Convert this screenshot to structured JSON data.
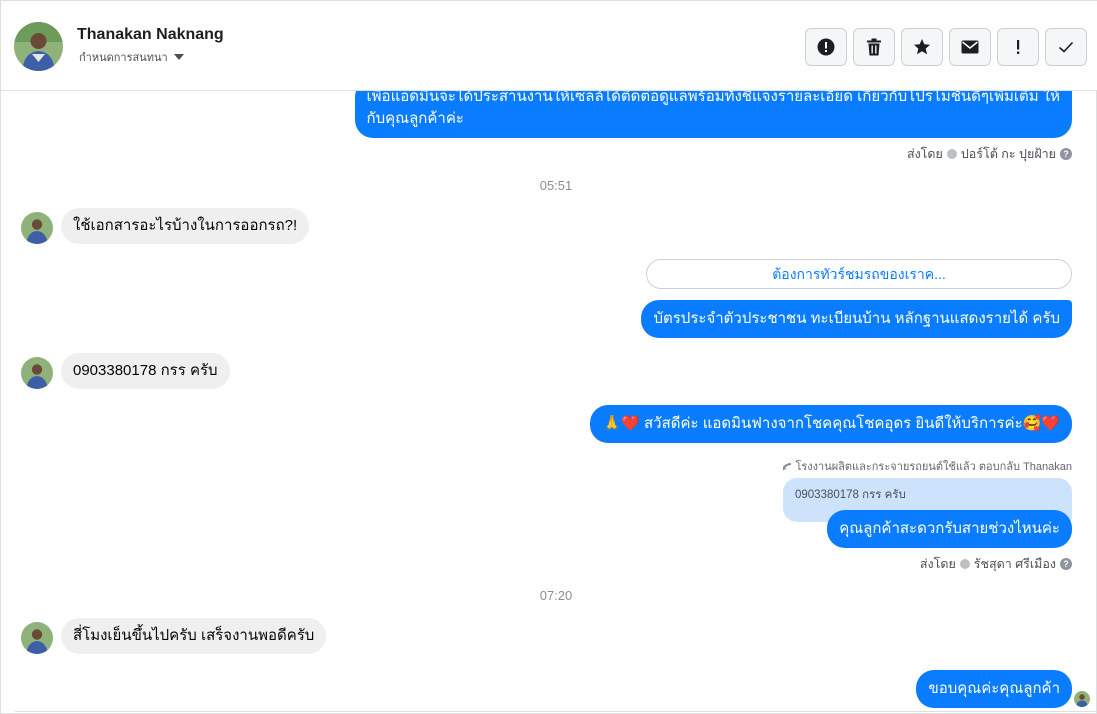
{
  "header": {
    "name": "Thanakan Naknang",
    "subtitle": "กำหนดการสนทนา",
    "actions": [
      "alert-circle-icon",
      "trash-icon",
      "star-icon",
      "envelope-icon",
      "exclamation-icon",
      "check-icon"
    ]
  },
  "messages": {
    "m1": {
      "line1": "เพื่อแอดมินจะได้ประสานงานให้เซลล์ได้ติดต่อดูแลพร้อมทั้งชี้แจงรายละเอียด เกี่ยวกับโปรโมชั่นดีๆเพิ่มเติม ให้",
      "line2": "กับคุณลูกค้าค่ะ"
    },
    "m1_meta": {
      "prefix": "ส่งโดย",
      "sender": "ปอร์โต้ กะ ปุยฝ้าย",
      "help": "?"
    },
    "time1": "05:51",
    "m2": "ใช้เอกสารอะไรบ้างในการออกรถ?!",
    "quick_reply": "ต้องการทัวร์ชมรถของเราค...",
    "m3": "บัตรประจำตัวประชาชน ทะเบียนบ้าน หลักฐานแสดงรายได้ ครับ",
    "m4": "0903380178  กรร  ครับ",
    "m5": "🙏❤️ สวัสดีค่ะ แอดมินฟางจากโชคคุณโชคอุดร ยินดีให้บริการค่ะ🥰❤️",
    "reply_note": "โรงงานผลิตและกระจายรถยนต์ใช้แล้ว ตอบกลับ Thanakan",
    "quoted": "0903380178 กรร ครับ",
    "m6": "คุณลูกค้าสะดวกรับสายช่วงไหนค่ะ",
    "m6_meta": {
      "prefix": "ส่งโดย",
      "sender": "รัชสุดา ศรีเมือง",
      "help": "?"
    },
    "time2": "07:20",
    "m7": "สี่โมงเย็นขึ้นไปครับ  เสร็จงานพอดีครับ",
    "m8": "ขอบคุณค่ะคุณลูกค้า"
  },
  "colors": {
    "outgoing": "#0a7cff",
    "incoming": "#efefef",
    "quoted": "#cde2fb"
  }
}
